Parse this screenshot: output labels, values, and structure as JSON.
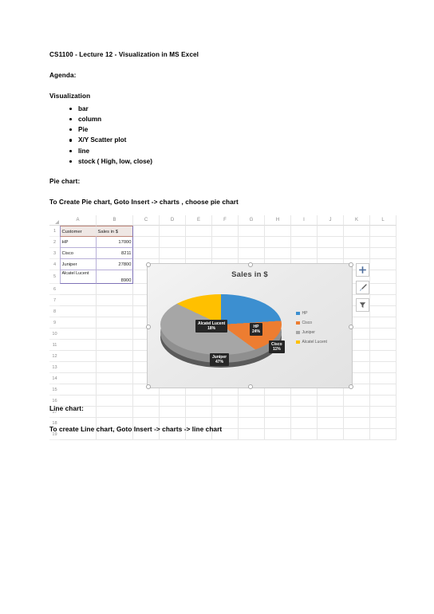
{
  "document": {
    "title": "CS1100 - Lecture 12 - Visualization in MS Excel",
    "agenda_heading": "Agenda:",
    "visualization_heading": "Visualization",
    "visualization_items": [
      "bar",
      "column",
      "Pie",
      "X/Y  Scatter plot",
      "line",
      "stock ( High, low, close)"
    ],
    "pie_chart_heading": "Pie chart:",
    "pie_chart_instruction": "To Create Pie chart, Goto Insert -> charts , choose pie chart",
    "line_chart_heading": "Line chart:",
    "line_chart_instruction": "To create Line chart, Goto Insert -> charts -> line chart"
  },
  "spreadsheet": {
    "column_headers": [
      "A",
      "B",
      "C",
      "D",
      "E",
      "F",
      "G",
      "H",
      "I",
      "J",
      "K",
      "L"
    ],
    "row_numbers": [
      "1",
      "2",
      "3",
      "4",
      "5",
      "6",
      "7",
      "8",
      "9",
      "10",
      "11",
      "12",
      "13",
      "14",
      "15",
      "16",
      "17",
      "18",
      "19"
    ],
    "header_row": {
      "a": "Customer",
      "b": "Sales in $"
    },
    "rows": [
      {
        "row": "2",
        "a": "HP",
        "b": "17000"
      },
      {
        "row": "3",
        "a": "Cisco",
        "b": "8211"
      },
      {
        "row": "4",
        "a": "Juniper",
        "b": "27800"
      },
      {
        "row": "5",
        "a": "Alcatel Lucent",
        "b": "8900"
      }
    ]
  },
  "chart": {
    "title": "Sales in $",
    "buttons": [
      {
        "name": "chart-elements-button",
        "glyph": "plus-icon"
      },
      {
        "name": "chart-styles-button",
        "glyph": "brush-icon"
      },
      {
        "name": "chart-filters-button",
        "glyph": "funnel-icon"
      }
    ],
    "legend": [
      {
        "label": "HP",
        "color": "#3c8fd0"
      },
      {
        "label": "Cisco",
        "color": "#ed7d31"
      },
      {
        "label": "Juniper",
        "color": "#a6a6a6"
      },
      {
        "label": "Alcatel Lucent",
        "color": "#ffc000"
      }
    ],
    "data_labels": {
      "alcatel": "Alcatel Lucent\n18%",
      "alcatel_name": "Alcatel Lucent",
      "alcatel_pct": "18%",
      "hp_name": "HP",
      "hp_pct": "24%",
      "cisco_name": "Cisco",
      "cisco_pct": "11%",
      "juniper_name": "Juniper",
      "juniper_pct": "47%"
    }
  },
  "chart_data": {
    "type": "pie",
    "title": "Sales in $",
    "categories": [
      "HP",
      "Cisco",
      "Juniper",
      "Alcatel Lucent"
    ],
    "values": [
      17000,
      8211,
      27800,
      8900
    ],
    "percentages": [
      24,
      11,
      47,
      18
    ],
    "colors": [
      "#3c8fd0",
      "#ed7d31",
      "#a6a6a6",
      "#ffc000"
    ],
    "legend_position": "right",
    "three_d": true,
    "data_labels": true,
    "xlabel": "",
    "ylabel": ""
  }
}
